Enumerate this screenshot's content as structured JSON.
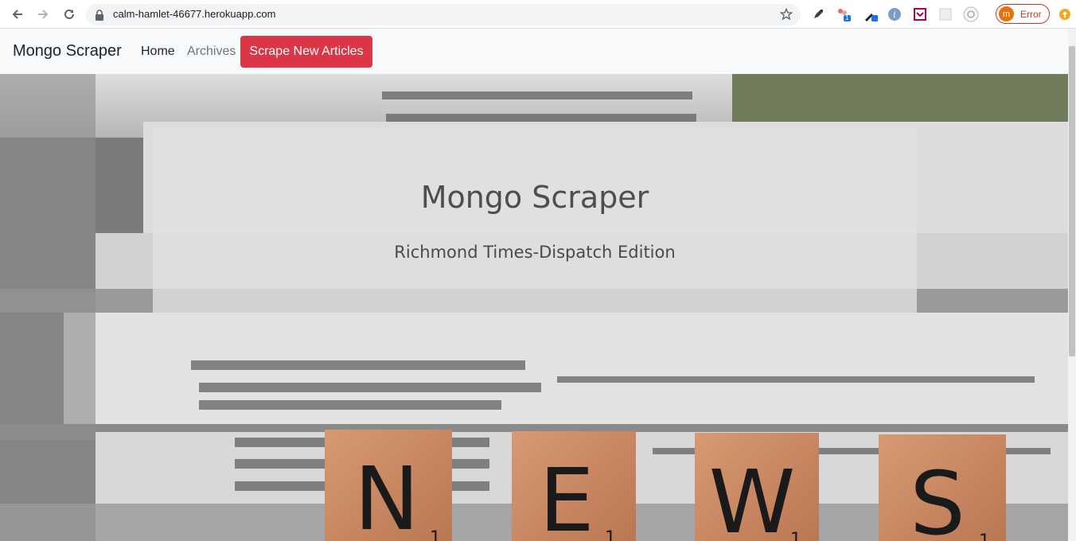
{
  "browser": {
    "url": "calm-hamlet-46677.herokuapp.com",
    "profile_initial": "m",
    "profile_status": "Error",
    "icons": [
      "back-icon",
      "forward-icon",
      "reload-icon",
      "lock-icon",
      "star-icon",
      "rocket-extension-icon",
      "extension-badge-icon",
      "eyedropper-extension-icon",
      "info-extension-icon",
      "pocket-extension-icon",
      "grid-extension-icon",
      "speed-extension-icon",
      "update-icon"
    ],
    "extension_badge": "1"
  },
  "navbar": {
    "brand": "Mongo Scraper",
    "links": [
      "Home",
      "Archives"
    ],
    "scrape_button": "Scrape New Articles",
    "accent": "#dc3545"
  },
  "hero": {
    "title": "Mongo Scraper",
    "subtitle": "Richmond Times-Dispatch Edition",
    "tiles": [
      {
        "letter": "N",
        "score": "1"
      },
      {
        "letter": "E",
        "score": "1"
      },
      {
        "letter": "W",
        "score": "1"
      },
      {
        "letter": "S",
        "score": "1"
      }
    ]
  }
}
